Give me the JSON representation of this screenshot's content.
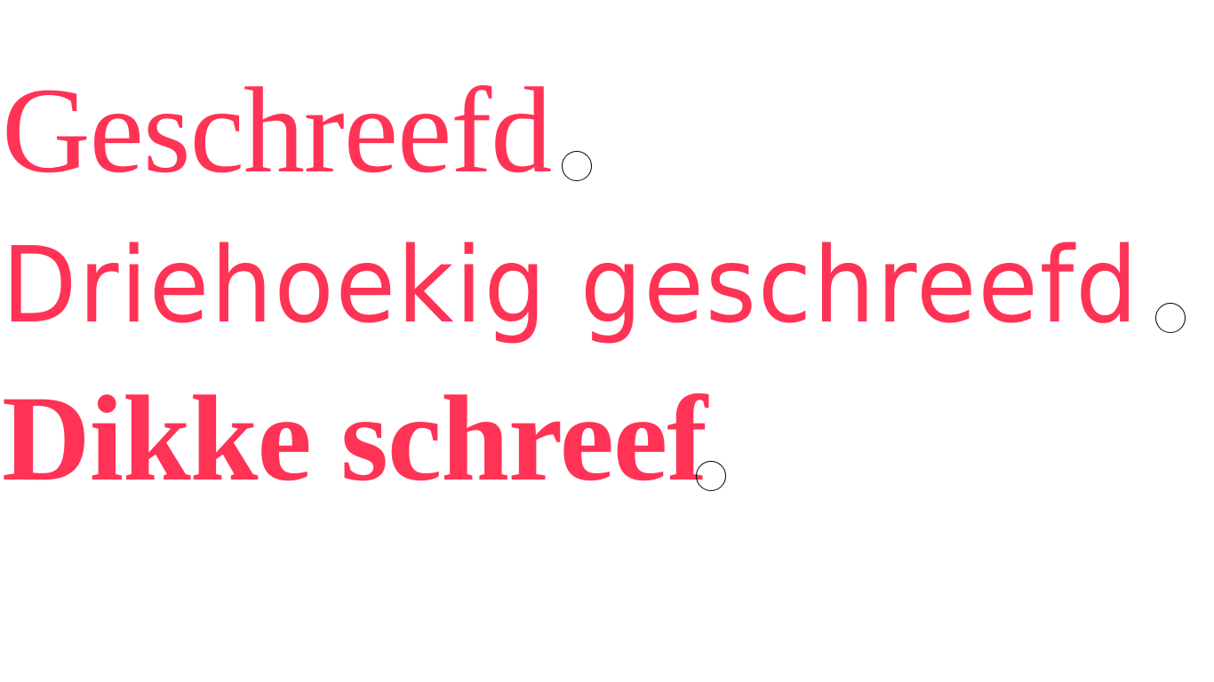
{
  "colors": {
    "text": "#ff3355",
    "marker": "#000000",
    "background": "#ffffff"
  },
  "lines": [
    {
      "text": "Geschreefd"
    },
    {
      "text": "Driehoekig geschreefd"
    },
    {
      "text": "Dikke schreef"
    }
  ]
}
